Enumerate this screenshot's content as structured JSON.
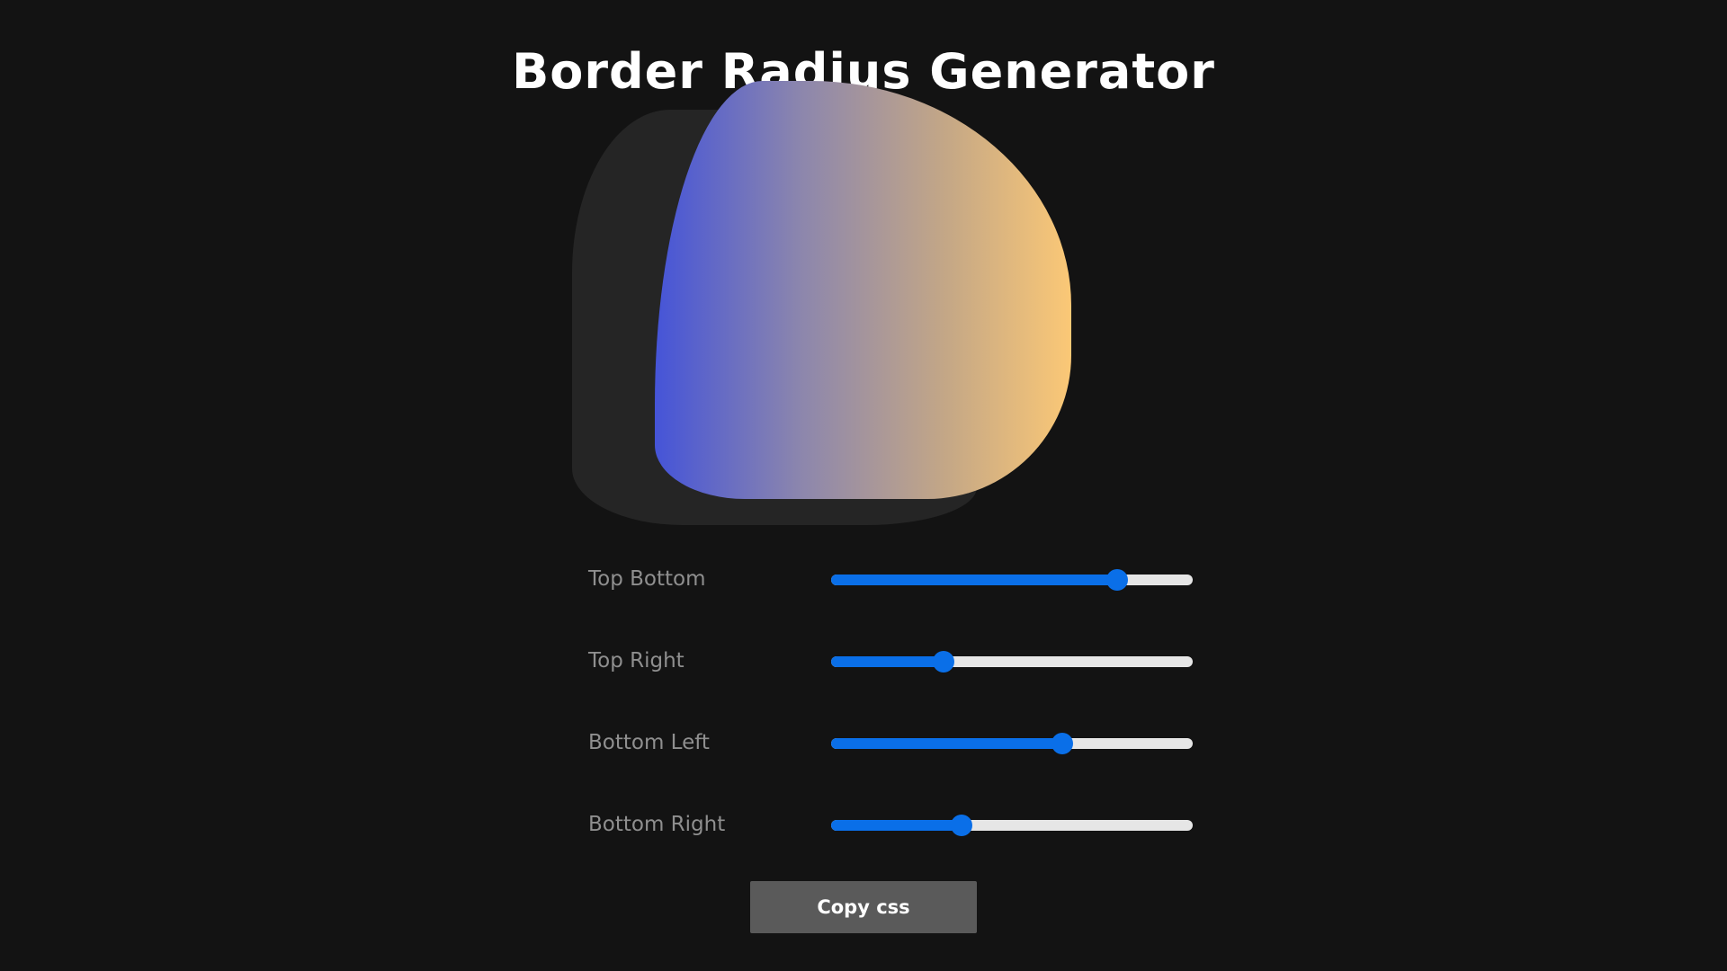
{
  "header": {
    "title": "Border Radius Generator"
  },
  "preview": {
    "gradient_start": "#4554d8",
    "gradient_end": "#fbc876",
    "shadow_color": "#252525"
  },
  "controls": [
    {
      "label": "Top Bottom",
      "value_pct": 79
    },
    {
      "label": "Top Right",
      "value_pct": 31
    },
    {
      "label": "Bottom Left",
      "value_pct": 64
    },
    {
      "label": "Bottom Right",
      "value_pct": 36
    }
  ],
  "actions": {
    "copy_label": "Copy css"
  },
  "colors": {
    "background": "#131313",
    "accent": "#0a6fe8",
    "track": "#e6e6e6",
    "button": "#5a5a5a",
    "label": "#8f8f8f"
  }
}
